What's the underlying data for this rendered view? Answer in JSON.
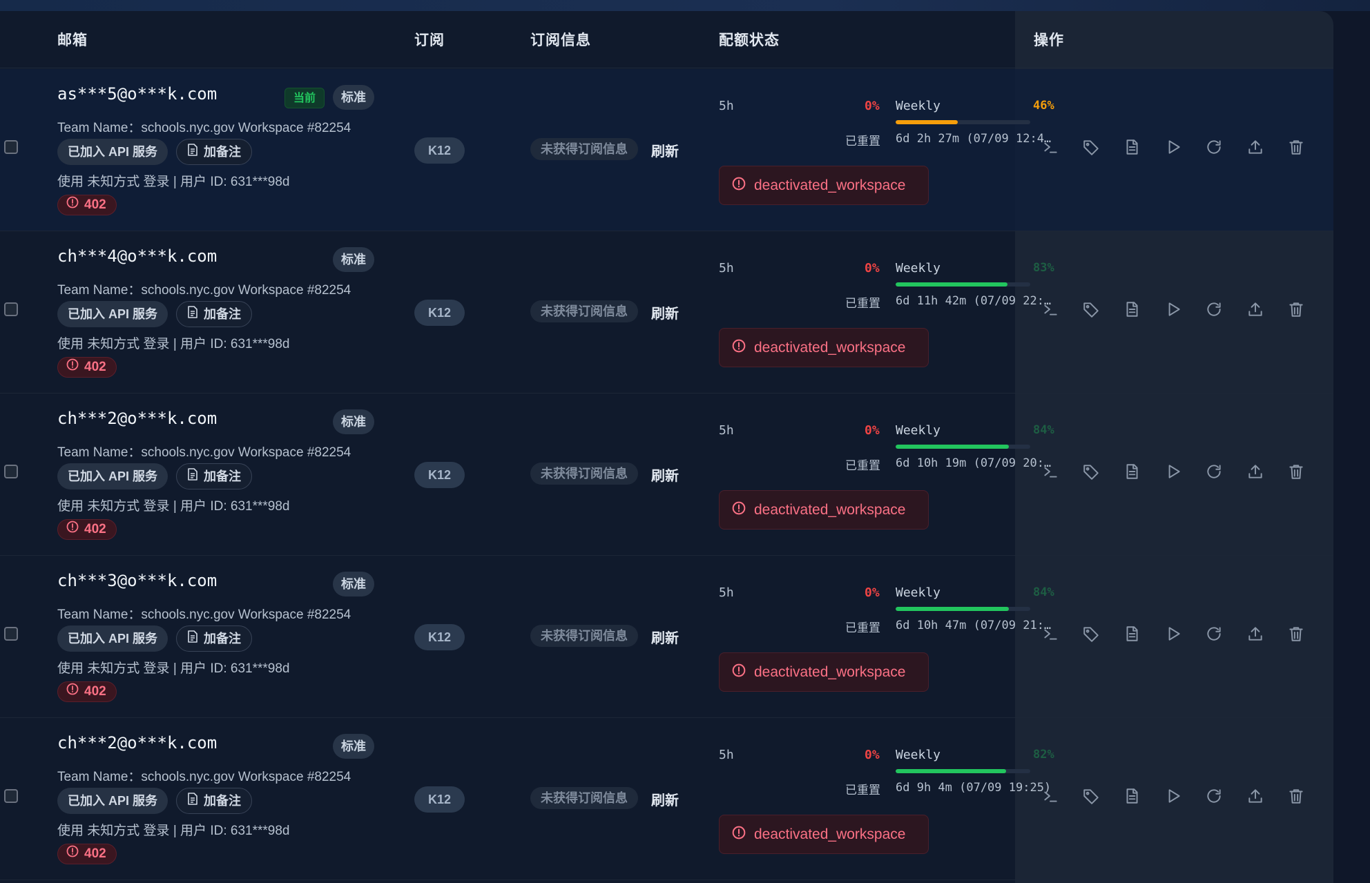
{
  "header": {
    "email": "邮箱",
    "subscription": "订阅",
    "sub_info": "订阅信息",
    "quota": "配额状态",
    "actions": "操作"
  },
  "colors": {
    "accent_red": "#ef4444",
    "green": "#22c55e",
    "orange": "#f59e0b"
  },
  "rows": [
    {
      "email": "as***5@o***k.com",
      "current_badge": "当前",
      "type_badge": "标准",
      "team": "Team Name：schools.nyc.gov Workspace #82254",
      "api_label": "已加入 API 服务",
      "note_label": "加备注",
      "login": "使用 未知方式 登录 | 用户 ID: 631***98d",
      "error_code": "402",
      "plan": "K12",
      "sub_info": "未获得订阅信息",
      "refresh": "刷新",
      "q5h_label": "5h",
      "q5h_pct": "0%",
      "weekly_label": "Weekly",
      "weekly_pct": "46%",
      "weekly_value": 0.46,
      "weekly_color": "#f59e0b",
      "reset_label": "已重置",
      "reset_val": "6d 2h 27m (07/09 12:4…",
      "status": "deactivated_workspace"
    },
    {
      "email": "ch***4@o***k.com",
      "type_badge": "标准",
      "team": "Team Name：schools.nyc.gov Workspace #82254",
      "api_label": "已加入 API 服务",
      "note_label": "加备注",
      "login": "使用 未知方式 登录 | 用户 ID: 631***98d",
      "error_code": "402",
      "plan": "K12",
      "sub_info": "未获得订阅信息",
      "refresh": "刷新",
      "q5h_label": "5h",
      "q5h_pct": "0%",
      "weekly_label": "Weekly",
      "weekly_pct": "83%",
      "weekly_value": 0.83,
      "weekly_color": "#22c55e",
      "reset_label": "已重置",
      "reset_val": "6d 11h 42m (07/09 22:…",
      "status": "deactivated_workspace"
    },
    {
      "email": "ch***2@o***k.com",
      "type_badge": "标准",
      "team": "Team Name：schools.nyc.gov Workspace #82254",
      "api_label": "已加入 API 服务",
      "note_label": "加备注",
      "login": "使用 未知方式 登录 | 用户 ID: 631***98d",
      "error_code": "402",
      "plan": "K12",
      "sub_info": "未获得订阅信息",
      "refresh": "刷新",
      "q5h_label": "5h",
      "q5h_pct": "0%",
      "weekly_label": "Weekly",
      "weekly_pct": "84%",
      "weekly_value": 0.84,
      "weekly_color": "#22c55e",
      "reset_label": "已重置",
      "reset_val": "6d 10h 19m (07/09 20:…",
      "status": "deactivated_workspace"
    },
    {
      "email": "ch***3@o***k.com",
      "type_badge": "标准",
      "team": "Team Name：schools.nyc.gov Workspace #82254",
      "api_label": "已加入 API 服务",
      "note_label": "加备注",
      "login": "使用 未知方式 登录 | 用户 ID: 631***98d",
      "error_code": "402",
      "plan": "K12",
      "sub_info": "未获得订阅信息",
      "refresh": "刷新",
      "q5h_label": "5h",
      "q5h_pct": "0%",
      "weekly_label": "Weekly",
      "weekly_pct": "84%",
      "weekly_value": 0.84,
      "weekly_color": "#22c55e",
      "reset_label": "已重置",
      "reset_val": "6d 10h 47m (07/09 21:…",
      "status": "deactivated_workspace"
    },
    {
      "email": "ch***2@o***k.com",
      "type_badge": "标准",
      "team": "Team Name：schools.nyc.gov Workspace #82254",
      "api_label": "已加入 API 服务",
      "note_label": "加备注",
      "login": "使用 未知方式 登录 | 用户 ID: 631***98d",
      "error_code": "402",
      "plan": "K12",
      "sub_info": "未获得订阅信息",
      "refresh": "刷新",
      "q5h_label": "5h",
      "q5h_pct": "0%",
      "weekly_label": "Weekly",
      "weekly_pct": "82%",
      "weekly_value": 0.82,
      "weekly_color": "#22c55e",
      "reset_label": "已重置",
      "reset_val": "6d 9h 4m (07/09 19:25)",
      "status": "deactivated_workspace"
    }
  ],
  "action_icons": [
    "terminal-icon",
    "tag-icon",
    "document-icon",
    "play-icon",
    "refresh-icon",
    "upload-icon",
    "trash-icon"
  ]
}
